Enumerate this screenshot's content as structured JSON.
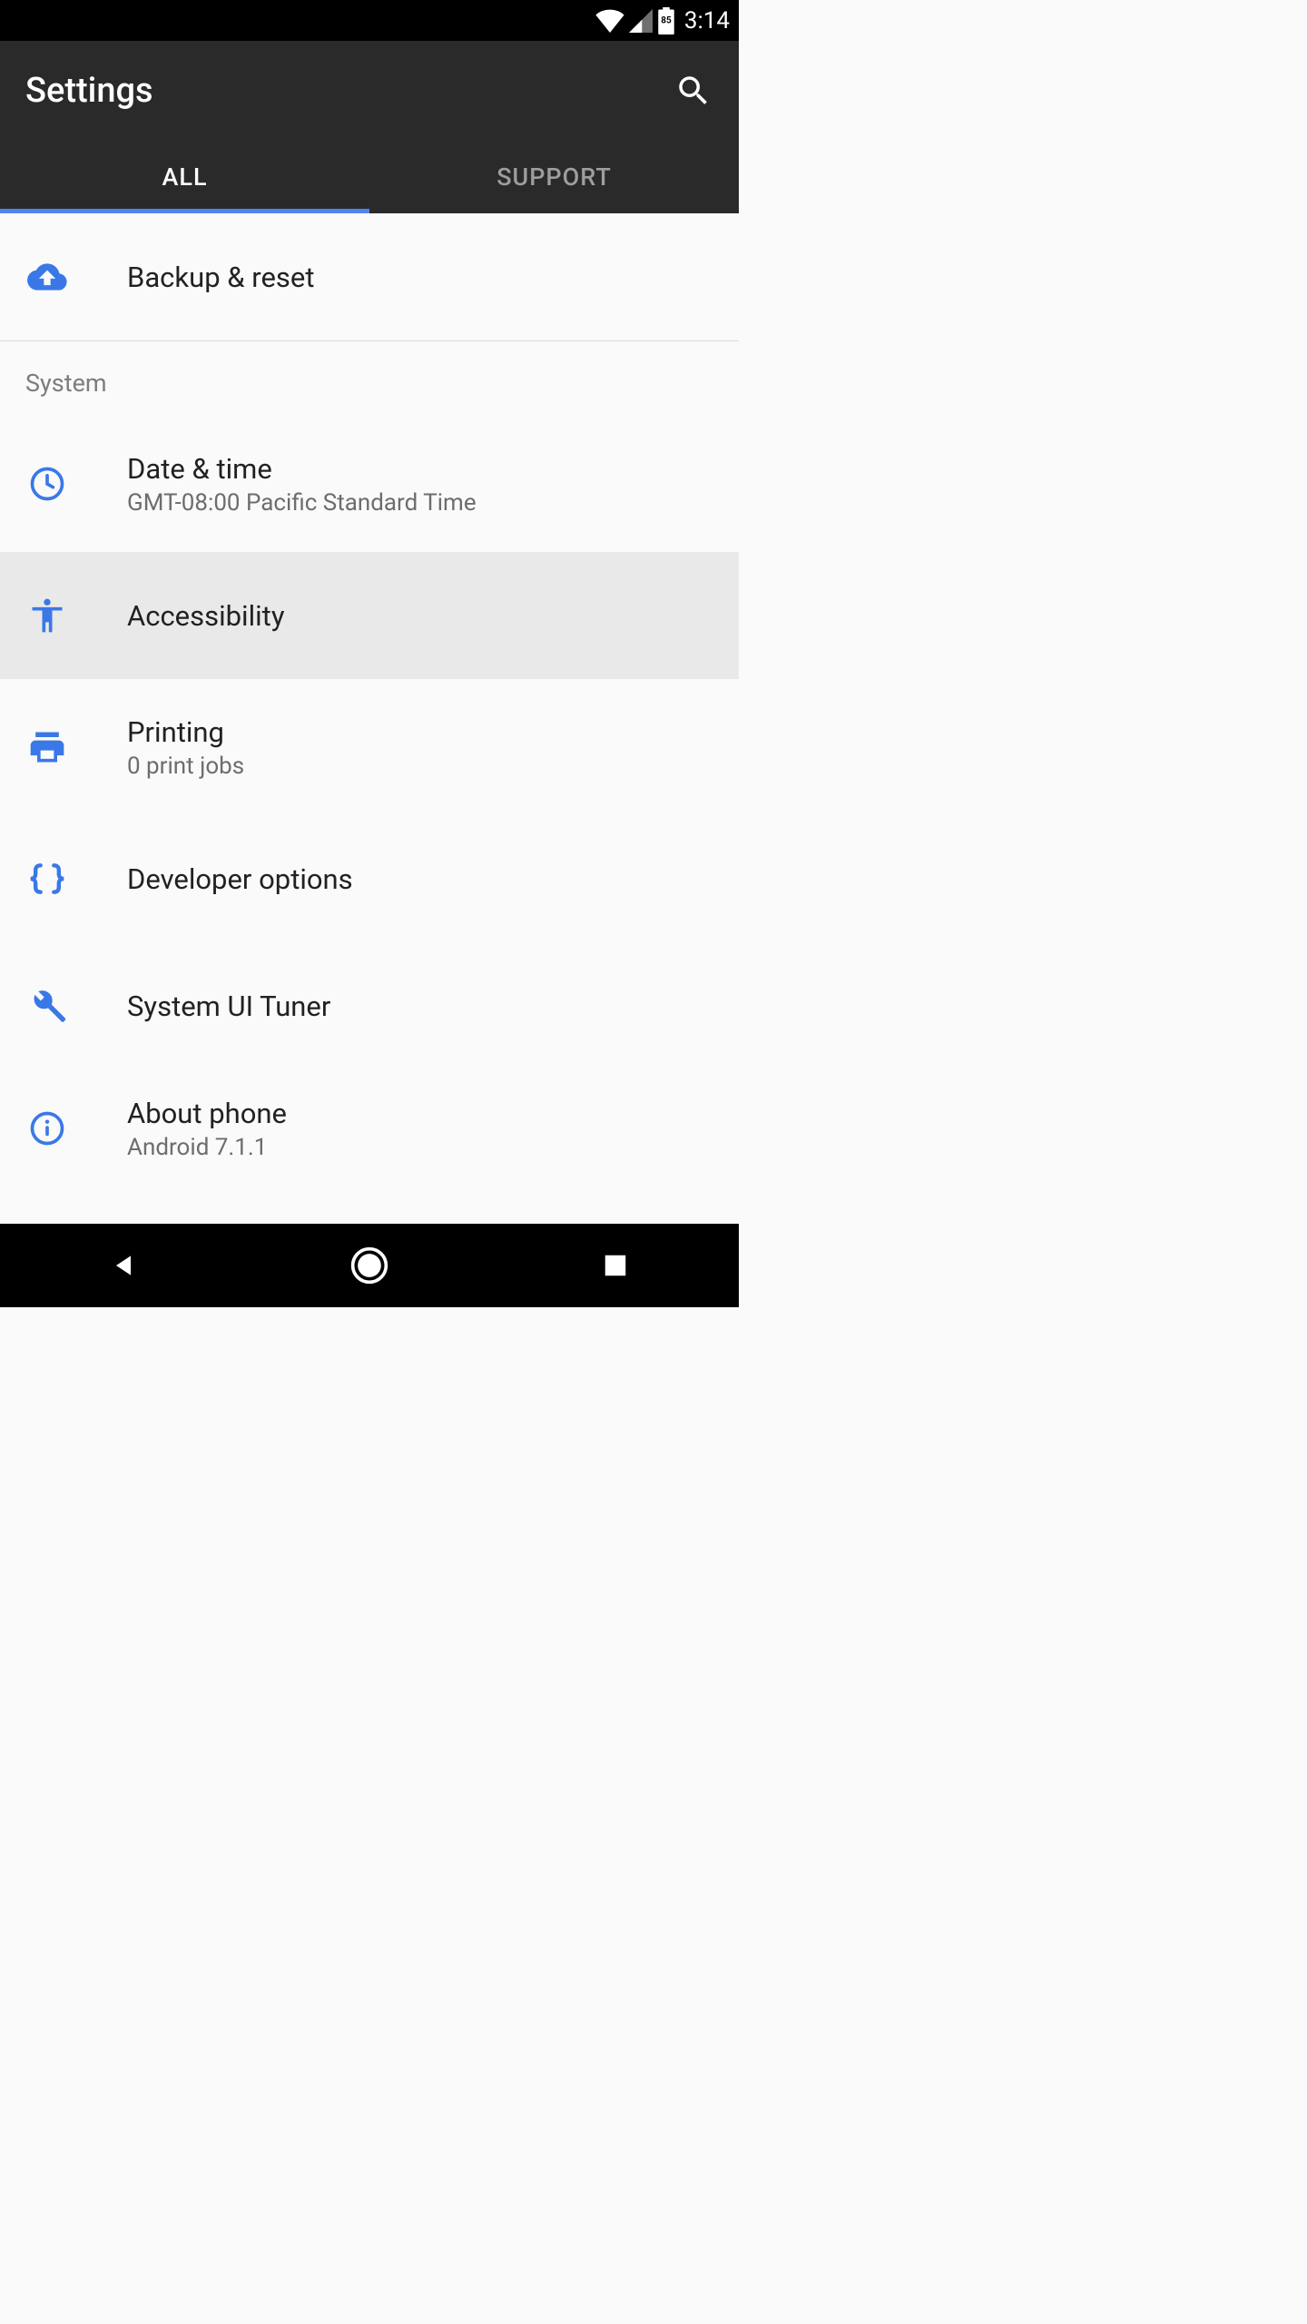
{
  "statusbar": {
    "battery": "85",
    "time": "3:14"
  },
  "appbar": {
    "title": "Settings"
  },
  "tabs": {
    "all": "ALL",
    "support": "SUPPORT"
  },
  "rows": {
    "backup": {
      "title": "Backup & reset"
    },
    "section_system": "System",
    "datetime": {
      "title": "Date & time",
      "sub": "GMT-08:00 Pacific Standard Time"
    },
    "accessibility": {
      "title": "Accessibility"
    },
    "printing": {
      "title": "Printing",
      "sub": "0 print jobs"
    },
    "developer": {
      "title": "Developer options"
    },
    "tuner": {
      "title": "System UI Tuner"
    },
    "about": {
      "title": "About phone",
      "sub": "Android 7.1.1"
    }
  },
  "colors": {
    "accent": "#3a78e7"
  }
}
